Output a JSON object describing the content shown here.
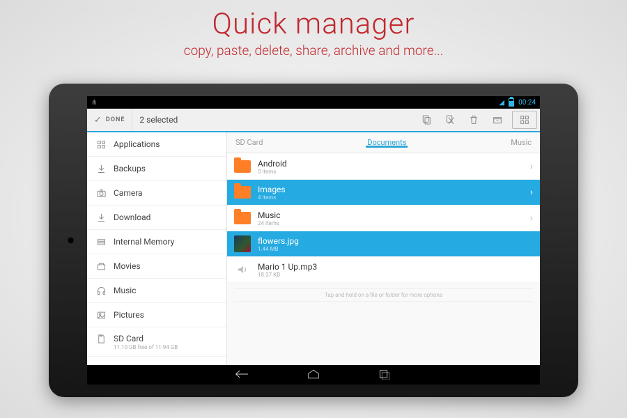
{
  "promo": {
    "title": "Quick manager",
    "subtitle": "copy, paste, delete, share, archive and more..."
  },
  "statusbar": {
    "time": "00:24"
  },
  "toolbar": {
    "done_label": "DONE",
    "selection_label": "2 selected"
  },
  "sidebar": {
    "items": [
      {
        "icon": "apps",
        "label": "Applications"
      },
      {
        "icon": "download",
        "label": "Backups"
      },
      {
        "icon": "camera",
        "label": "Camera"
      },
      {
        "icon": "download",
        "label": "Download"
      },
      {
        "icon": "memory",
        "label": "Internal Memory"
      },
      {
        "icon": "movies",
        "label": "Movies"
      },
      {
        "icon": "music",
        "label": "Music"
      },
      {
        "icon": "pictures",
        "label": "Pictures"
      }
    ],
    "storage": {
      "label": "SD Card",
      "sub": "11.10 GB free of 11.94 GB"
    }
  },
  "tabs": {
    "left": "SD Card",
    "center": "Documents",
    "right": "Music"
  },
  "rows": [
    {
      "type": "folder",
      "name": "Android",
      "sub": "0 items",
      "selected": false,
      "chevron": true
    },
    {
      "type": "folder",
      "name": "Images",
      "sub": "4 items",
      "selected": true,
      "chevron": true
    },
    {
      "type": "folder",
      "name": "Music",
      "sub": "24 items",
      "selected": false,
      "chevron": true
    },
    {
      "type": "image",
      "name": "flowers.jpg",
      "sub": "1.44 MB",
      "selected": true,
      "chevron": false
    },
    {
      "type": "audio",
      "name": "Mario 1 Up.mp3",
      "sub": "18.37 KB",
      "selected": false,
      "chevron": false
    }
  ],
  "hint": "Tap and hold on a file or folder for more options"
}
